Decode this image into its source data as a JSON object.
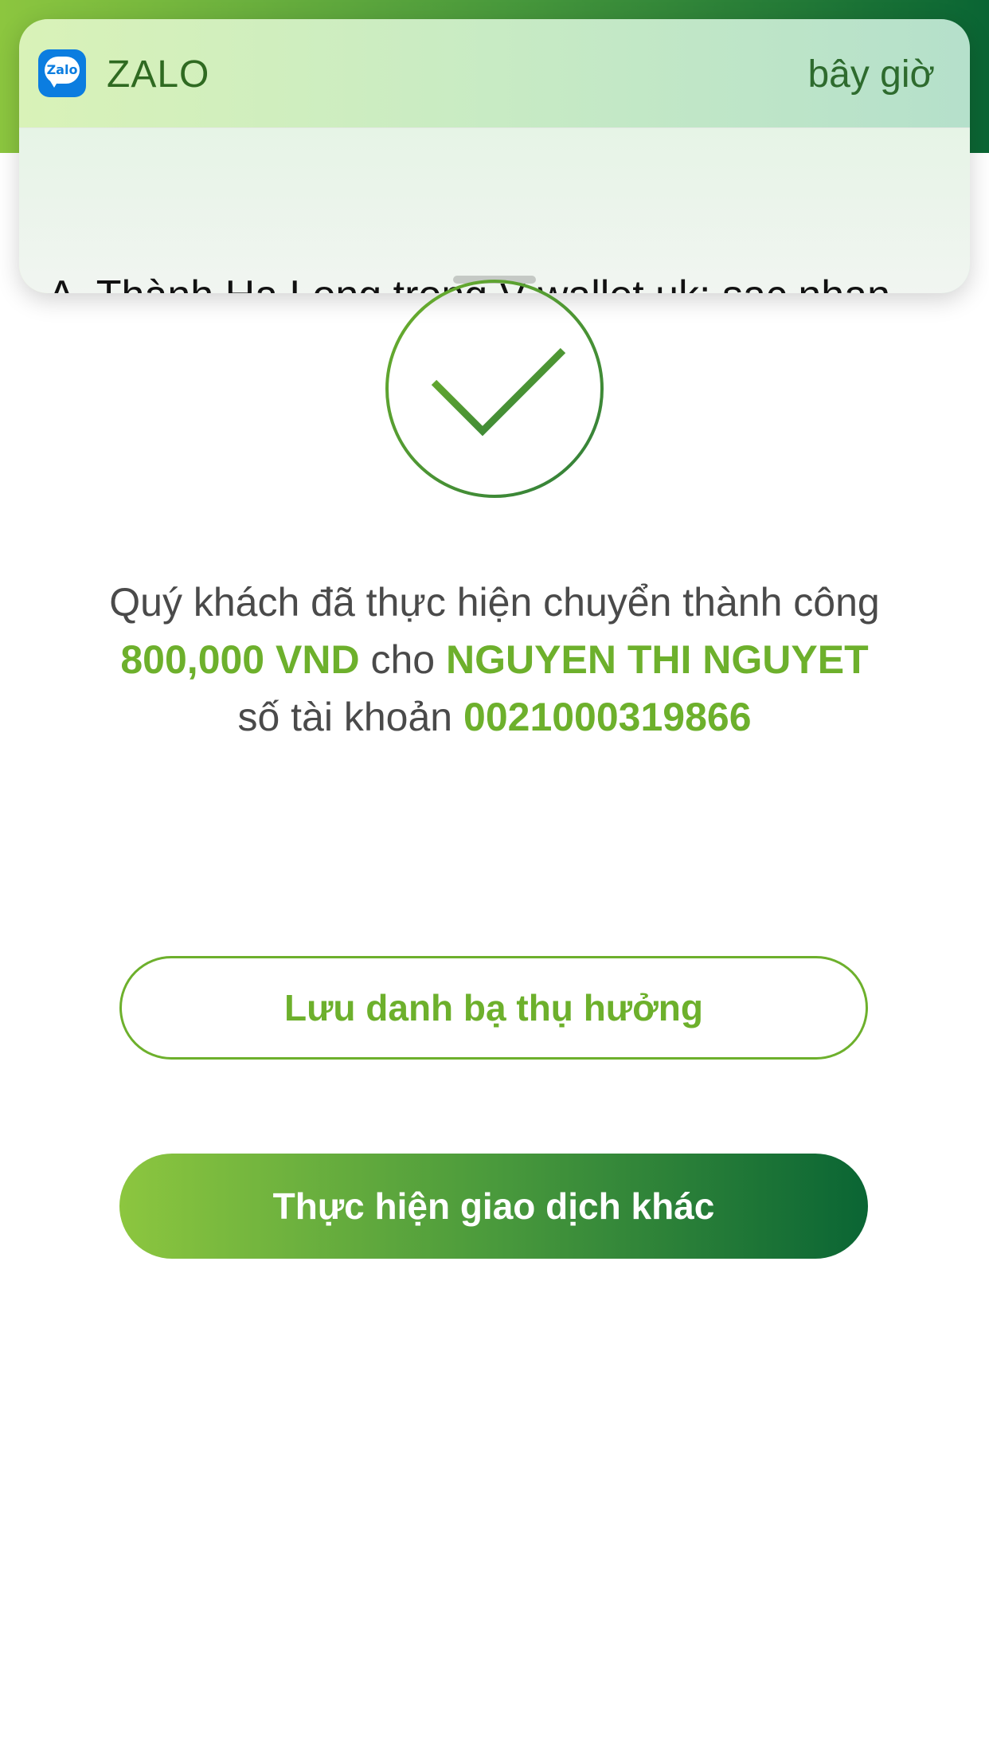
{
  "notification": {
    "app_name": "ZALO",
    "app_icon_label": "Zalo",
    "time": "bây giờ",
    "message": "A .Thành Hạ Long trong V-wallet.uk: sac nhan rôi"
  },
  "result": {
    "line1": "Quý khách đã thực hiện chuyển thành công",
    "amount": "800,000 VND",
    "connector": "cho",
    "recipient": "NGUYEN THI NGUYET",
    "account_prefix": "số tài khoản",
    "account_number": "0021000319866"
  },
  "actions": {
    "save_contact": "Lưu danh bạ thụ hưởng",
    "new_transaction": "Thực hiện giao dịch khác"
  },
  "colors": {
    "accent_green": "#6db02c",
    "gradient_start": "#8cc63f",
    "gradient_end": "#0a6534"
  },
  "icons": {
    "success": "checkmark-circle-icon",
    "app": "zalo-app-icon"
  }
}
